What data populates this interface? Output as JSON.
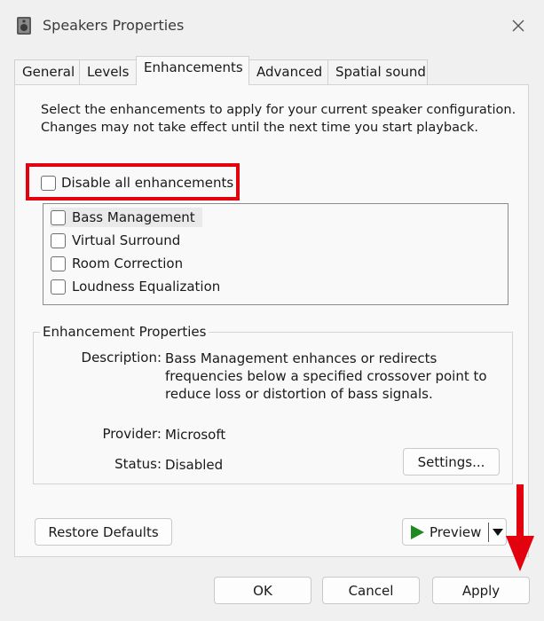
{
  "window": {
    "title": "Speakers Properties",
    "close_glyph": "✕"
  },
  "tabs": [
    {
      "label": "General",
      "active": false
    },
    {
      "label": "Levels",
      "active": false
    },
    {
      "label": "Enhancements",
      "active": true
    },
    {
      "label": "Advanced",
      "active": false
    },
    {
      "label": "Spatial sound",
      "active": false
    }
  ],
  "enhancements": {
    "intro": "Select the enhancements to apply for your current speaker configuration. Changes may not take effect until the next time you start playback.",
    "disable_all_label": "Disable all enhancements",
    "items": [
      {
        "label": "Bass Management",
        "checked": false,
        "selected": true
      },
      {
        "label": "Virtual Surround",
        "checked": false,
        "selected": false
      },
      {
        "label": "Room Correction",
        "checked": false,
        "selected": false
      },
      {
        "label": "Loudness Equalization",
        "checked": false,
        "selected": false
      }
    ]
  },
  "properties": {
    "group_title": "Enhancement Properties",
    "description_label": "Description:",
    "description_value": "Bass Management enhances or redirects frequencies below a specified crossover point to reduce loss or distortion of bass signals.",
    "provider_label": "Provider:",
    "provider_value": "Microsoft",
    "status_label": "Status:",
    "status_value": "Disabled",
    "settings_button": "Settings..."
  },
  "actions": {
    "restore_defaults": "Restore Defaults",
    "preview": "Preview",
    "ok": "OK",
    "cancel": "Cancel",
    "apply": "Apply"
  },
  "colors": {
    "highlight_box": "#e3000f",
    "arrow": "#e3000f",
    "play_icon": "#1f8a1f"
  }
}
